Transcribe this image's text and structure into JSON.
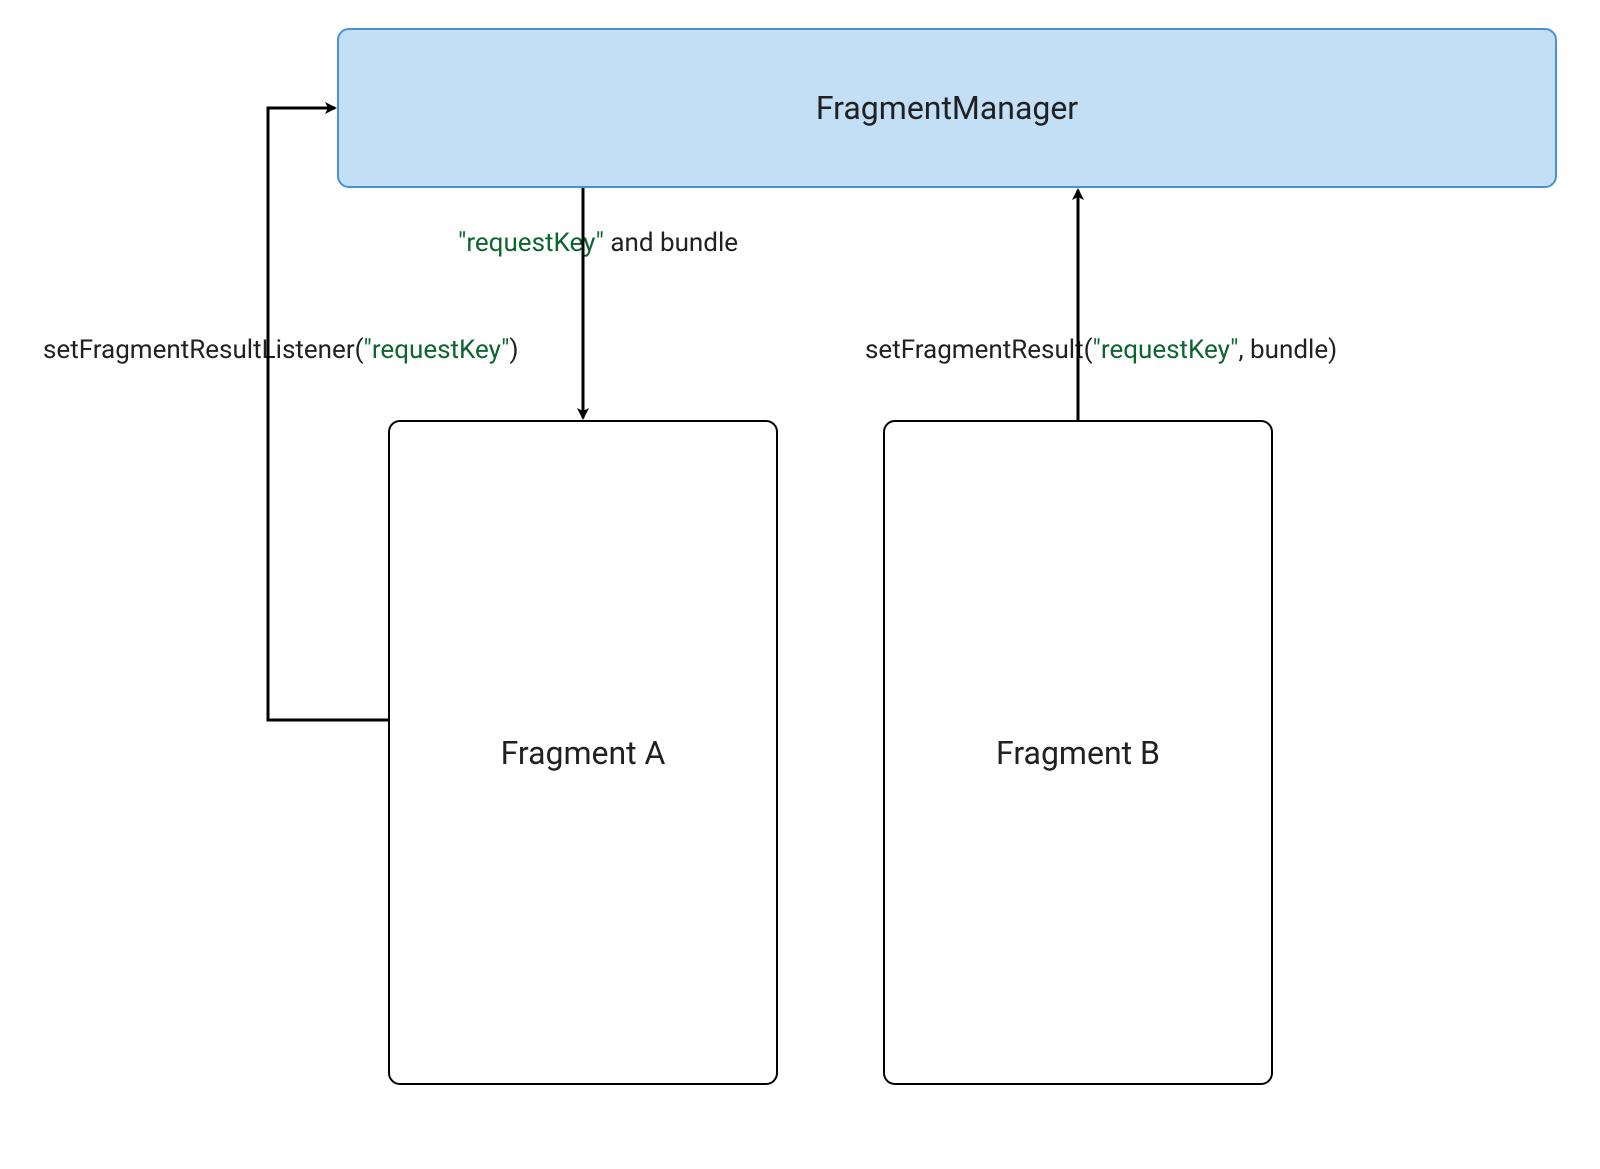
{
  "boxes": {
    "fragment_manager": "FragmentManager",
    "fragment_a": "Fragment A",
    "fragment_b": "Fragment B"
  },
  "labels": {
    "listener_pre": "setFragmentResultListener(",
    "listener_key": "\"requestKey\"",
    "listener_post": ")",
    "center_key": "\"requestKey\"",
    "center_post": " and bundle",
    "result_pre": "setFragmentResult(",
    "result_key": "\"requestKey\"",
    "result_post": ", bundle)"
  }
}
